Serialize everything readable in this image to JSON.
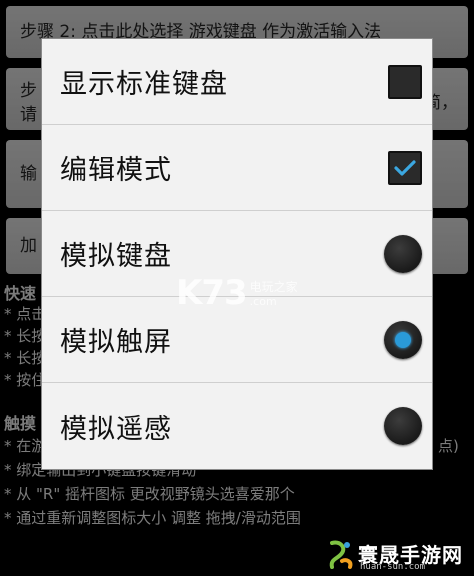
{
  "background": {
    "buttons": [
      {
        "label": "步骤 2: 点击此处选择 游戏键盘 作为激活输入法"
      },
      {
        "label": "步",
        "right": "简，"
      },
      {
        "label": "请",
        "right": ""
      },
      {
        "label": "输"
      },
      {
        "label": "加"
      }
    ],
    "sections": [
      {
        "heading": "快速",
        "lines": [
          "* 点击",
          "* 长按",
          "* 长按",
          "* 按住"
        ]
      },
      {
        "heading": "触摸",
        "lines": [
          "* 在游",
          "* 绑定输出到小键盘按键滑动",
          "* 从 \"R\" 摇杆图标 更改视野镜头选喜爱那个",
          "* 通过重新调整图标大小 调整 拖拽/滑动范围"
        ]
      }
    ],
    "tail_right": "点)"
  },
  "dialog": {
    "items": [
      {
        "label": "显示标准键盘",
        "control": "checkbox",
        "checked": false
      },
      {
        "label": "编辑模式",
        "control": "checkbox",
        "checked": true
      },
      {
        "label": "模拟键盘",
        "control": "radio",
        "selected": false
      },
      {
        "label": "模拟触屏",
        "control": "radio",
        "selected": true
      },
      {
        "label": "模拟遥感",
        "control": "radio",
        "selected": false
      }
    ]
  },
  "watermark": {
    "logo": "K73",
    "cn": "电玩之家",
    "en": ".com"
  },
  "corner_logo": {
    "name": "寰晟手游网",
    "url": "huan-sun.com"
  },
  "colors": {
    "accent": "#2a9ad8",
    "dialog_bg": "#f2f2f2",
    "check": "#3ba7e0"
  }
}
